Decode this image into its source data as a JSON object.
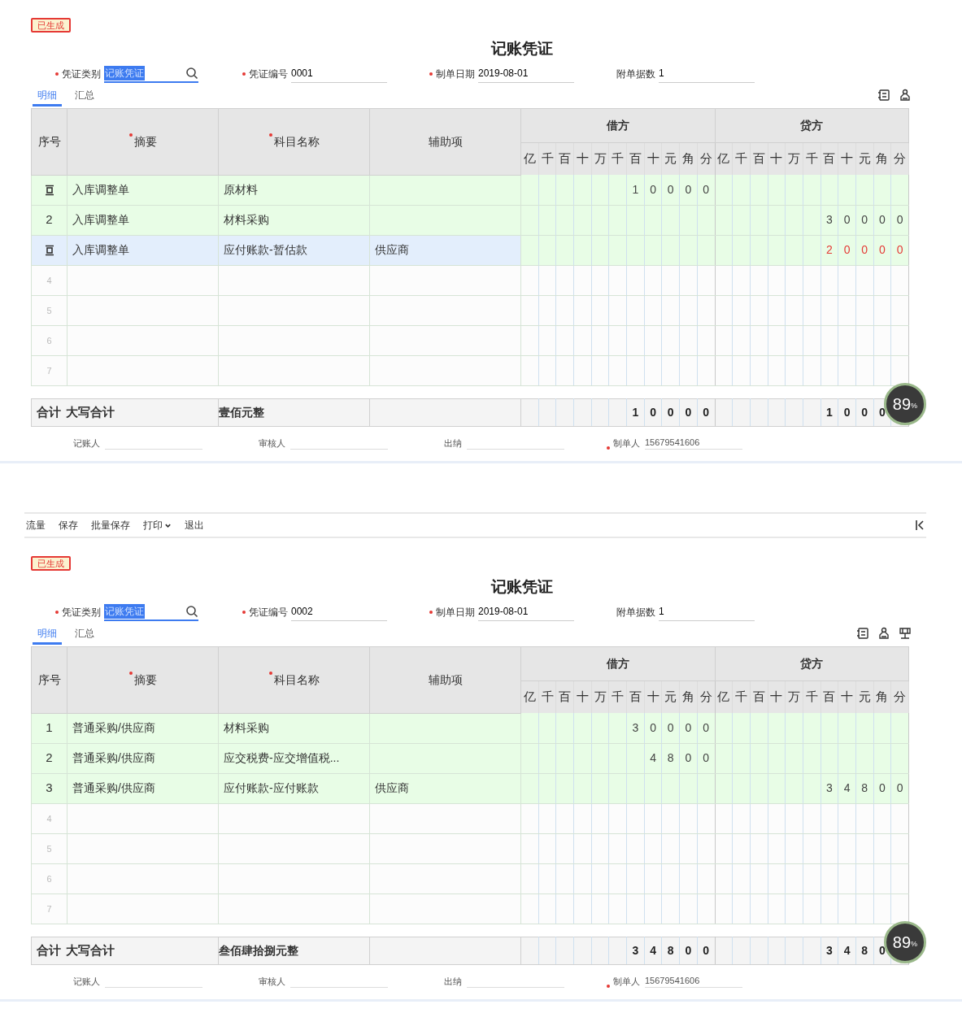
{
  "sections": [
    {
      "kind": "voucher",
      "status": "已生成",
      "title": "记账凭证",
      "fields": [
        {
          "label": "凭证类别",
          "value": "记账凭证",
          "required": true,
          "kind": "lookup",
          "selected": true
        },
        {
          "label": "凭证编号",
          "value": "0001",
          "required": true,
          "kind": "text",
          "selected": false
        },
        {
          "label": "制单日期",
          "value": "2019-08-01",
          "required": true,
          "kind": "text",
          "selected": false
        },
        {
          "label": "附单据数",
          "value": "1",
          "required": false,
          "kind": "text",
          "selected": false
        }
      ],
      "tabs": [
        {
          "label": "明细",
          "selected": true
        },
        {
          "label": "汇总",
          "selected": false
        }
      ],
      "tools": [
        {
          "kind": "list"
        },
        {
          "kind": "stamp"
        }
      ],
      "table": {
        "columns": [
          {
            "label": "序号",
            "required": false
          },
          {
            "label": "摘要",
            "required": true
          },
          {
            "label": "科目名称",
            "required": true
          },
          {
            "label": "辅助项",
            "required": false
          }
        ],
        "debit_label": "借方",
        "credit_label": "贷方",
        "debit_units": [
          "亿",
          "千",
          "百",
          "十",
          "万",
          "千",
          "百",
          "十",
          "元",
          "角",
          "分"
        ],
        "credit_units": [
          "亿",
          "千",
          "百",
          "十",
          "万",
          "千",
          "百",
          "十",
          "元",
          "角",
          "分"
        ],
        "rows": [
          {
            "kind": "icon",
            "summary": "入库调整单",
            "account": "原材料",
            "debit": [
              "1",
              "0",
              "0",
              "0",
              "0"
            ],
            "selected": false
          },
          {
            "kind": "number",
            "number": "2",
            "summary": "入库调整单",
            "account": "材料采购",
            "credit": [
              "3",
              "0",
              "0",
              "0",
              "0"
            ],
            "selected": false
          },
          {
            "kind": "icon",
            "summary": "入库调整单",
            "account": "应付账款-暂估款",
            "aux": "供应商",
            "credit": [
              "2",
              "0",
              "0",
              "0",
              "0"
            ],
            "negative": true,
            "selected": true
          },
          {
            "kind": "number",
            "number": "4",
            "selected": false
          },
          {
            "kind": "number",
            "number": "5",
            "selected": false
          },
          {
            "kind": "number",
            "number": "6",
            "selected": false
          },
          {
            "kind": "number",
            "number": "7",
            "selected": false
          }
        ],
        "totals": {
          "label": "合计",
          "caption": "大写合计",
          "words": "壹佰元整",
          "debit": [
            "1",
            "0",
            "0",
            "0",
            "0"
          ],
          "credit": [
            "1",
            "0",
            "0",
            "0"
          ]
        }
      },
      "signers": [
        {
          "label": "记账人",
          "required": false
        },
        {
          "label": "审核人",
          "required": false
        },
        {
          "label": "出纳",
          "required": false
        },
        {
          "label": "制单人",
          "required": true,
          "value": "15679541606"
        }
      ],
      "progress_badge": {
        "value": "89",
        "unit": "%"
      }
    },
    {
      "kind": "action_bar",
      "items": [
        {
          "label": "流量",
          "has_menu": false
        },
        {
          "label": "保存",
          "has_menu": false
        },
        {
          "label": "批量保存",
          "has_menu": false
        },
        {
          "label": "打印",
          "has_menu": true
        },
        {
          "label": "退出",
          "has_menu": false
        }
      ]
    },
    {
      "kind": "voucher",
      "status": "已生成",
      "title": "记账凭证",
      "fields": [
        {
          "label": "凭证类别",
          "value": "记账凭证",
          "required": true,
          "kind": "lookup",
          "selected": true
        },
        {
          "label": "凭证编号",
          "value": "0002",
          "required": true,
          "kind": "text",
          "selected": false
        },
        {
          "label": "制单日期",
          "value": "2019-08-01",
          "required": true,
          "kind": "text",
          "selected": false
        },
        {
          "label": "附单据数",
          "value": "1",
          "required": false,
          "kind": "text",
          "selected": false
        }
      ],
      "tabs": [
        {
          "label": "明细",
          "selected": true
        },
        {
          "label": "汇总",
          "selected": false
        }
      ],
      "tools": [
        {
          "kind": "list"
        },
        {
          "kind": "stamp"
        },
        {
          "kind": "approve"
        }
      ],
      "table": {
        "columns": [
          {
            "label": "序号",
            "required": false
          },
          {
            "label": "摘要",
            "required": true
          },
          {
            "label": "科目名称",
            "required": true
          },
          {
            "label": "辅助项",
            "required": false
          }
        ],
        "debit_label": "借方",
        "credit_label": "贷方",
        "debit_units": [
          "亿",
          "千",
          "百",
          "十",
          "万",
          "千",
          "百",
          "十",
          "元",
          "角",
          "分"
        ],
        "credit_units": [
          "亿",
          "千",
          "百",
          "十",
          "万",
          "千",
          "百",
          "十",
          "元",
          "角",
          "分"
        ],
        "rows": [
          {
            "kind": "number",
            "number": "1",
            "summary": "普通采购/供应商",
            "account": "材料采购",
            "debit": [
              "3",
              "0",
              "0",
              "0",
              "0"
            ],
            "selected": false
          },
          {
            "kind": "number",
            "number": "2",
            "summary": "普通采购/供应商",
            "account": "应交税费-应交增值税...",
            "debit": [
              "4",
              "8",
              "0",
              "0"
            ],
            "selected": false
          },
          {
            "kind": "number",
            "number": "3",
            "summary": "普通采购/供应商",
            "account": "应付账款-应付账款",
            "aux": "供应商",
            "credit": [
              "3",
              "4",
              "8",
              "0",
              "0"
            ],
            "selected": false
          },
          {
            "kind": "number",
            "number": "4",
            "selected": false
          },
          {
            "kind": "number",
            "number": "5",
            "selected": false
          },
          {
            "kind": "number",
            "number": "6",
            "selected": false
          },
          {
            "kind": "number",
            "number": "7",
            "selected": false
          }
        ],
        "totals": {
          "label": "合计",
          "caption": "大写合计",
          "words": "叁佰肆拾捌元整",
          "debit": [
            "3",
            "4",
            "8",
            "0",
            "0"
          ],
          "credit": [
            "3",
            "4",
            "8",
            "0"
          ]
        }
      },
      "signers": [
        {
          "label": "记账人",
          "required": false
        },
        {
          "label": "审核人",
          "required": false
        },
        {
          "label": "出纳",
          "required": false
        },
        {
          "label": "制单人",
          "required": true,
          "value": "15679541606"
        }
      ],
      "progress_badge": {
        "value": "89",
        "unit": "%"
      }
    }
  ]
}
